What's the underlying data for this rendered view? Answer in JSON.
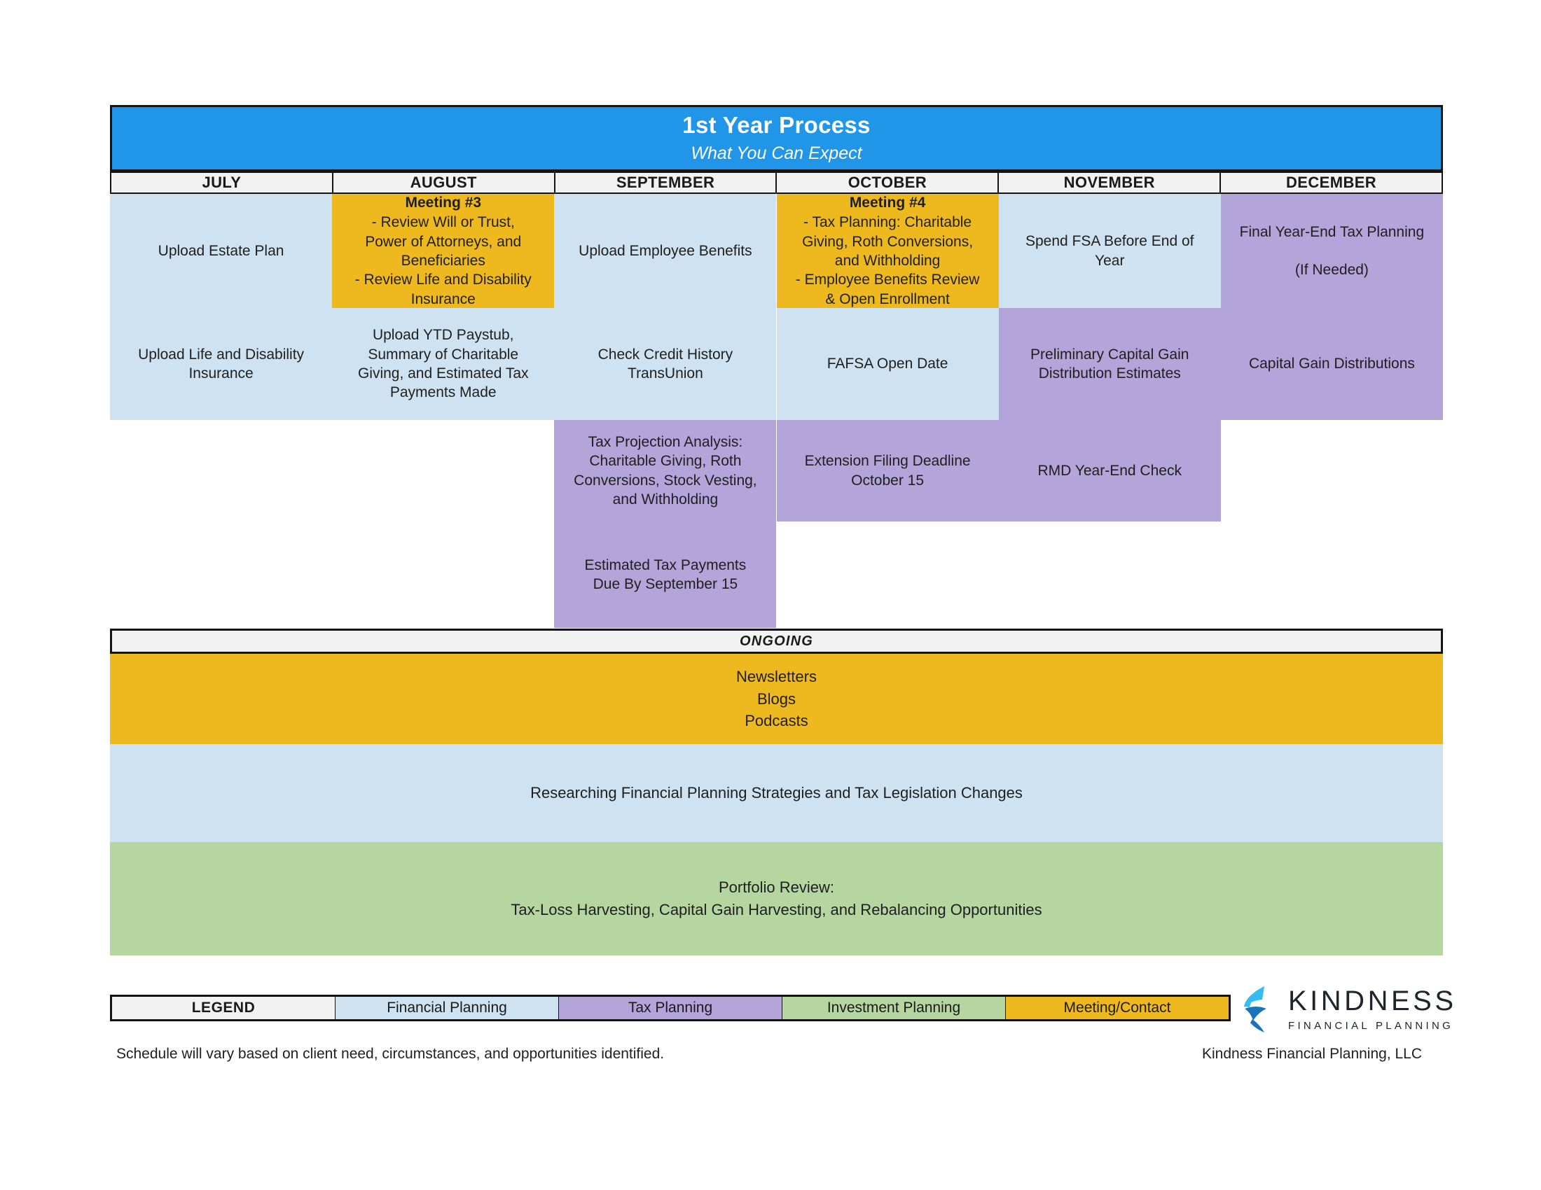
{
  "title": {
    "main": "1st Year Process",
    "sub": "What You Can Expect",
    "bg": "#2196e8"
  },
  "months": [
    "JULY",
    "AUGUST",
    "SEPTEMBER",
    "OCTOBER",
    "NOVEMBER",
    "DECEMBER"
  ],
  "colors": {
    "financial_planning": "#cfe2f1",
    "tax_planning": "#b3a4d9",
    "investment_planning": "#b5d6a0",
    "meeting_contact": "#eeb81f",
    "header_grey": "#f2f2f2",
    "border": "#141414",
    "logo_light_blue": "#35bdf2",
    "logo_dark_blue": "#1a73b8"
  },
  "cells": [
    {
      "month": "JULY",
      "row": 1,
      "category": "financial_planning",
      "text": "Upload Estate Plan"
    },
    {
      "month": "JULY",
      "row": 2,
      "category": "financial_planning",
      "text": "Upload Life and Disability\nInsurance"
    },
    {
      "month": "AUGUST",
      "row": 1,
      "category": "meeting_contact",
      "heading": "Meeting #3",
      "text": "- Review Will or Trust,\nPower of Attorneys, and\nBeneficiaries\n- Review Life and Disability\nInsurance"
    },
    {
      "month": "AUGUST",
      "row": 2,
      "category": "financial_planning",
      "text": "Upload YTD Paystub,\nSummary of Charitable\nGiving, and Estimated Tax\nPayments Made"
    },
    {
      "month": "SEPTEMBER",
      "row": 1,
      "category": "financial_planning",
      "text": "Upload Employee Benefits"
    },
    {
      "month": "SEPTEMBER",
      "row": 2,
      "category": "financial_planning",
      "text": "Check Credit History\nTransUnion"
    },
    {
      "month": "SEPTEMBER",
      "row": 3,
      "category": "tax_planning",
      "text": "Tax Projection Analysis:\nCharitable Giving, Roth\nConversions, Stock Vesting,\nand Withholding"
    },
    {
      "month": "SEPTEMBER",
      "row": 4,
      "category": "tax_planning",
      "text": "Estimated Tax Payments\nDue By September 15"
    },
    {
      "month": "OCTOBER",
      "row": 1,
      "category": "meeting_contact",
      "heading": "Meeting #4",
      "text": "- Tax Planning: Charitable\nGiving, Roth Conversions,\nand Withholding\n- Employee Benefits Review\n& Open Enrollment"
    },
    {
      "month": "OCTOBER",
      "row": 2,
      "category": "financial_planning",
      "text": "FAFSA Open Date"
    },
    {
      "month": "OCTOBER",
      "row": 3,
      "category": "tax_planning",
      "text": "Extension Filing Deadline\nOctober 15"
    },
    {
      "month": "NOVEMBER",
      "row": 1,
      "category": "financial_planning",
      "text": "Spend FSA Before End of\nYear"
    },
    {
      "month": "NOVEMBER",
      "row": 2,
      "category": "tax_planning",
      "text": "Preliminary Capital Gain\nDistribution Estimates"
    },
    {
      "month": "NOVEMBER",
      "row": 3,
      "category": "tax_planning",
      "text": "RMD Year-End Check"
    },
    {
      "month": "DECEMBER",
      "row": 1,
      "category": "tax_planning",
      "text": "Final Year-End Tax Planning\n\n(If Needed)"
    },
    {
      "month": "DECEMBER",
      "row": 2,
      "category": "tax_planning",
      "text": "Capital Gain Distributions"
    }
  ],
  "ongoing": {
    "label": "ONGOING",
    "bands": [
      {
        "category": "meeting_contact",
        "text": "Newsletters\nBlogs\nPodcasts"
      },
      {
        "category": "financial_planning",
        "text": "Researching Financial Planning Strategies and Tax Legislation Changes"
      },
      {
        "category": "investment_planning",
        "text": "Portfolio Review:\nTax-Loss Harvesting, Capital Gain Harvesting, and Rebalancing Opportunities"
      }
    ]
  },
  "legend": {
    "title": "LEGEND",
    "items": [
      {
        "label": "Financial Planning",
        "category": "financial_planning"
      },
      {
        "label": "Tax Planning",
        "category": "tax_planning"
      },
      {
        "label": "Investment Planning",
        "category": "investment_planning"
      },
      {
        "label": "Meeting/Contact",
        "category": "meeting_contact"
      }
    ]
  },
  "logo": {
    "word": "KINDNESS",
    "sub": "FINANCIAL PLANNING"
  },
  "footer": {
    "left": "Schedule will vary based on client need, circumstances, and opportunities identified.",
    "right": "Kindness Financial Planning, LLC"
  }
}
